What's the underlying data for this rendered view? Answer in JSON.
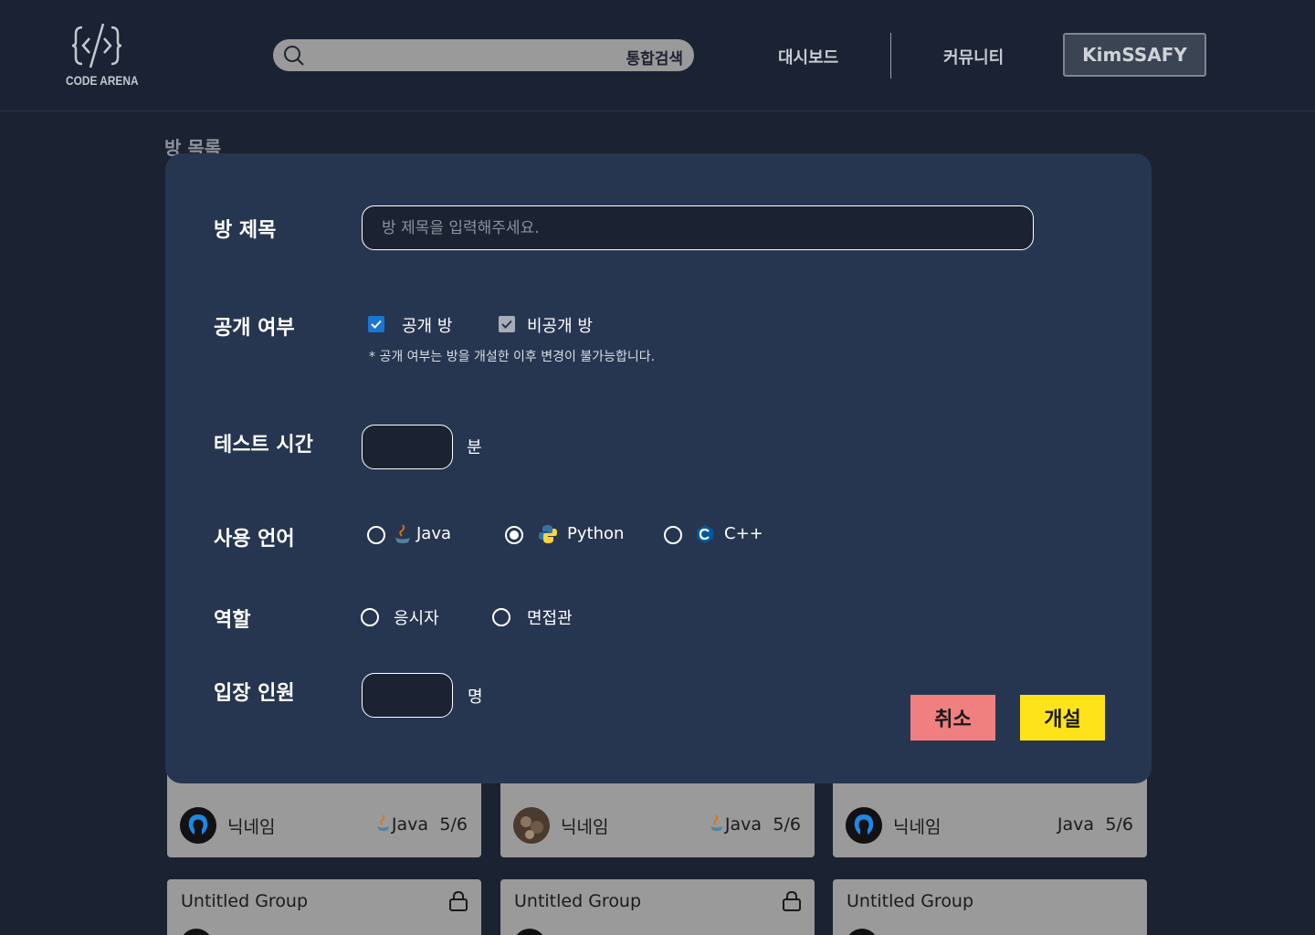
{
  "header": {
    "logo_text": "CODE ARENA",
    "search_label": "통합검색",
    "nav": {
      "dashboard": "대시보드",
      "community": "커뮤니티"
    },
    "user_button": "KimSSAFY"
  },
  "page_title": "방 목록",
  "cards": [
    {
      "nickname": "닉네임",
      "language": "Java",
      "count": "5/6"
    },
    {
      "nickname": "닉네임",
      "language": "Java",
      "count": "5/6"
    },
    {
      "nickname": "닉네임",
      "language": "Java",
      "count": "5/6"
    }
  ],
  "cards_row2": [
    {
      "title": "Untitled Group"
    },
    {
      "title": "Untitled Group"
    },
    {
      "title": "Untitled Group"
    }
  ],
  "modal": {
    "room_title_label": "방 제목",
    "room_title_placeholder": "방 제목을 입력해주세요.",
    "visibility_label": "공개 여부",
    "public_label": "공개 방",
    "private_label": "비공개 방",
    "visibility_note": "* 공개 여부는 방을 개설한 이후 변경이 불가능합니다.",
    "test_time_label": "테스트 시간",
    "test_time_unit": "분",
    "language_label": "사용 언어",
    "languages": [
      "Java",
      "Python",
      "C++"
    ],
    "selected_language": "Python",
    "role_label": "역할",
    "roles": [
      "응시자",
      "면접관"
    ],
    "capacity_label": "입장 인원",
    "capacity_unit": "명",
    "cancel_button": "취소",
    "create_button": "개설"
  },
  "colors": {
    "background": "#1b2332",
    "modal": "#273650",
    "cancel": "#f08080",
    "create": "#ffe31a",
    "checkbox_checked": "#1976d2"
  }
}
